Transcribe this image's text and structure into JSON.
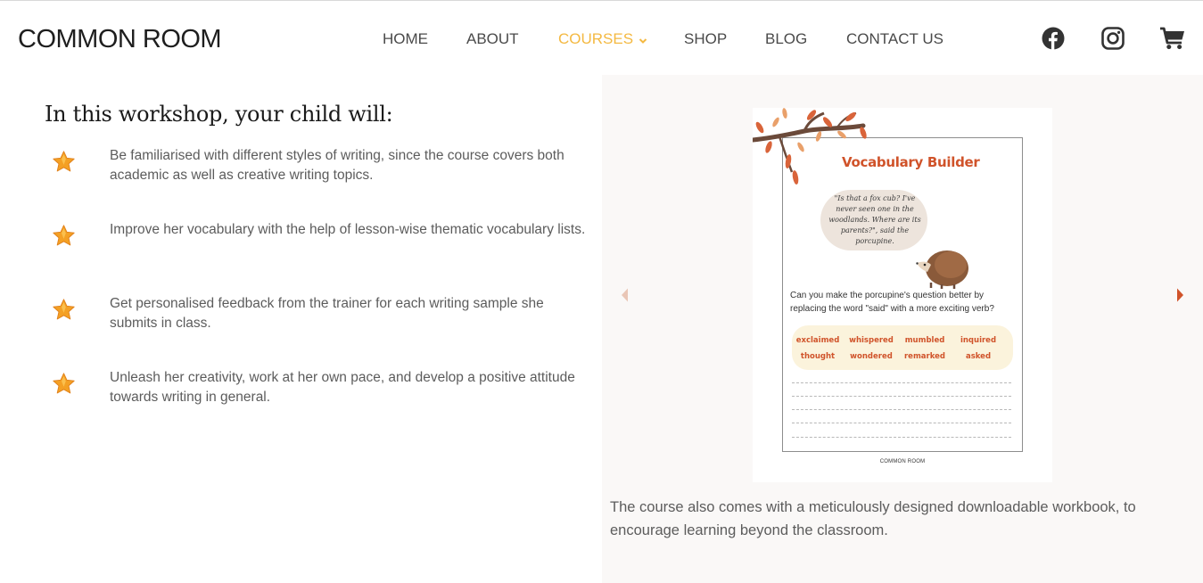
{
  "brand": {
    "logo": "COMMON ROOM"
  },
  "nav": {
    "items": [
      {
        "label": "HOME"
      },
      {
        "label": "ABOUT"
      },
      {
        "label": "COURSES"
      },
      {
        "label": "SHOP"
      },
      {
        "label": "BLOG"
      },
      {
        "label": "CONTACT US"
      }
    ],
    "active": "COURSES"
  },
  "social": {
    "icons": [
      "facebook-icon",
      "instagram-icon",
      "cart-icon"
    ]
  },
  "colors": {
    "accent": "#f4b942",
    "star": "#f4a024",
    "workbook_title": "#d0532a",
    "panel_bg": "#faf8f7",
    "arrow": "#d0532a"
  },
  "section": {
    "heading": "In this workshop, your child will:",
    "bullets": [
      {
        "text": "Be familiarised with different styles of writing, since the course covers both academic as well as creative writing topics."
      },
      {
        "text": "Improve her vocabulary with the help of lesson-wise thematic vocabulary lists."
      },
      {
        "text": "Get personalised feedback from the trainer for each writing sample she submits in class."
      },
      {
        "text": "Unleash her creativity, work at her own pace, and develop a positive attitude towards writing in general."
      }
    ]
  },
  "workbook": {
    "title": "Vocabulary Builder",
    "bubble": "\"Is that a fox cub? I've never seen one in the woodlands. Where are its parents?\", said the porcupine.",
    "question": "Can you make the porcupine's question better by replacing the word \"said\" with a more exciting verb?",
    "words": [
      "exclaimed",
      "whispered",
      "mumbled",
      "inquired",
      "thought",
      "wondered",
      "remarked",
      "asked"
    ],
    "footer": "COMMON ROOM"
  },
  "caption": "The course also comes with a meticulously designed downloadable workbook, to encourage learning beyond the classroom."
}
